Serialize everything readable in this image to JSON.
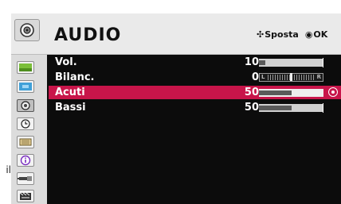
{
  "side_text": "il",
  "header": {
    "title": "AUDIO",
    "icon": "speaker-icon",
    "hint_move_glyph": "✣",
    "hint_move_label": "Sposta",
    "hint_ok_glyph": "◉",
    "hint_ok_label": "OK"
  },
  "sidebar": {
    "items": [
      {
        "name": "picture-menu-icon"
      },
      {
        "name": "screen-menu-icon"
      },
      {
        "name": "audio-menu-icon",
        "active": true
      },
      {
        "name": "time-menu-icon"
      },
      {
        "name": "options-menu-icon"
      },
      {
        "name": "info-menu-icon"
      },
      {
        "name": "input-menu-icon"
      },
      {
        "name": "media-menu-icon"
      }
    ]
  },
  "rows": [
    {
      "label": "Vol.",
      "value": "10",
      "type": "bar",
      "level": 0.1
    },
    {
      "label": "Bilanc.",
      "value": "0",
      "type": "balance",
      "left_letter": "L",
      "right_letter": "R"
    },
    {
      "label": "Acuti",
      "value": "50",
      "type": "bar",
      "level": 0.5,
      "selected": true
    },
    {
      "label": "Bassi",
      "value": "50",
      "type": "bar",
      "level": 0.5
    }
  ],
  "colors": {
    "selected_row": "#c8154a",
    "background": "#0c0c0c",
    "header": "#eaeaea",
    "sidebar": "#dcdcdc"
  }
}
